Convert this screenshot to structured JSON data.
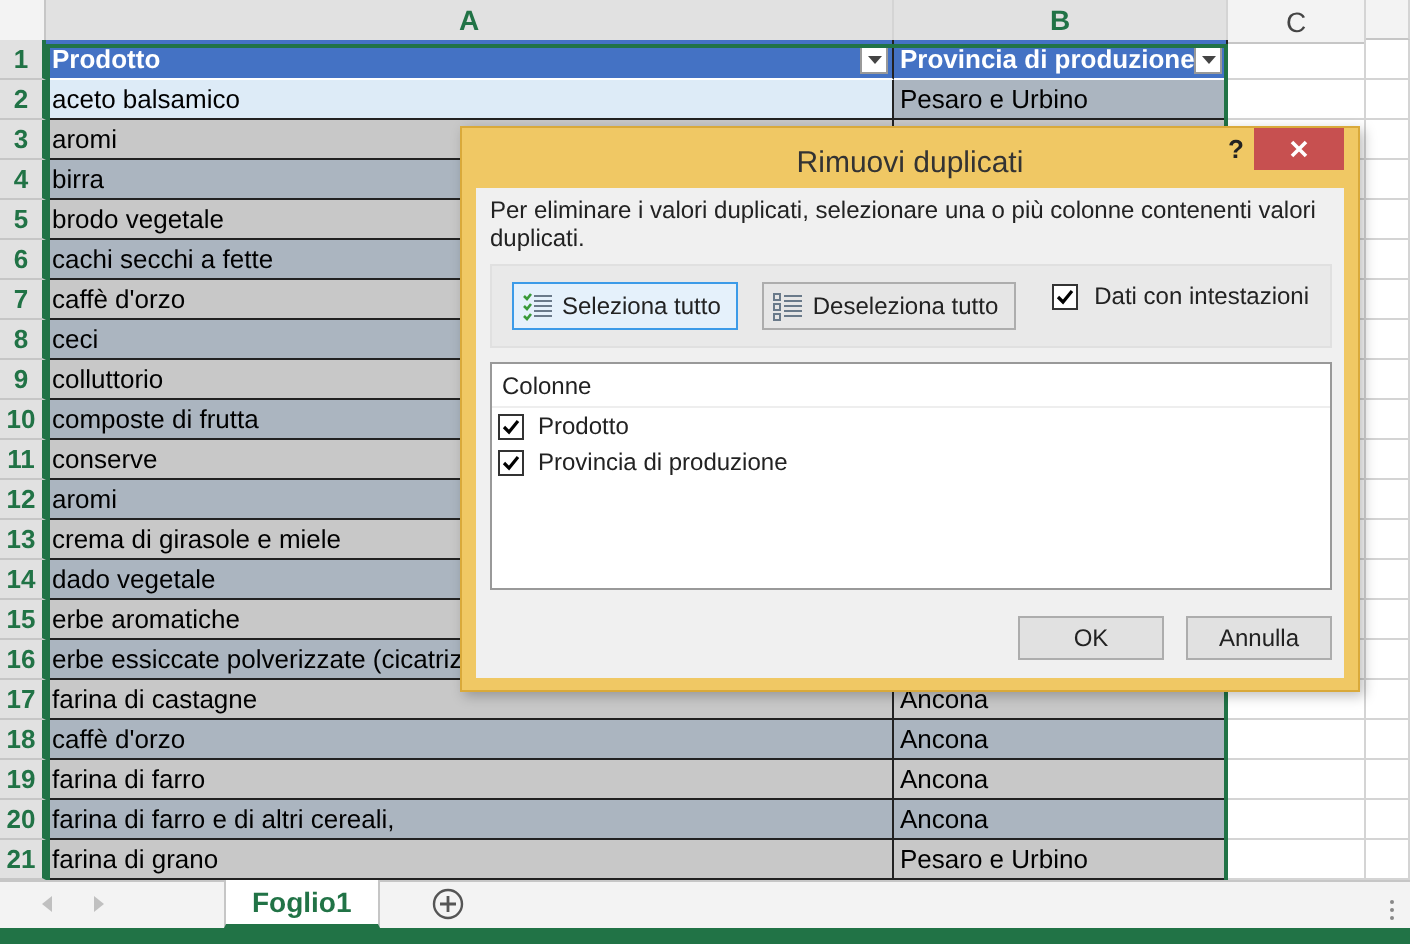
{
  "column_headers": [
    {
      "label": "A",
      "selected": true
    },
    {
      "label": "B",
      "selected": true
    },
    {
      "label": "C",
      "selected": false
    }
  ],
  "rows": [
    {
      "number": "1",
      "kind": "header",
      "cells": [
        "Prodotto",
        "Provincia di produzione"
      ]
    },
    {
      "number": "2",
      "kind": "data",
      "active": true,
      "cells": [
        "aceto balsamico",
        "Pesaro e Urbino"
      ]
    },
    {
      "number": "3",
      "kind": "data",
      "active": false,
      "cells": [
        "aromi"
      ]
    },
    {
      "number": "4",
      "kind": "data",
      "active": false,
      "cells": [
        "birra"
      ]
    },
    {
      "number": "5",
      "kind": "data",
      "active": false,
      "cells": [
        "brodo vegetale"
      ]
    },
    {
      "number": "6",
      "kind": "data",
      "active": false,
      "cells": [
        "cachi secchi a fette"
      ]
    },
    {
      "number": "7",
      "kind": "data",
      "active": false,
      "cells": [
        "caffè d'orzo"
      ]
    },
    {
      "number": "8",
      "kind": "data",
      "active": false,
      "cells": [
        "ceci"
      ]
    },
    {
      "number": "9",
      "kind": "data",
      "active": false,
      "cells": [
        "colluttorio"
      ]
    },
    {
      "number": "10",
      "kind": "data",
      "active": false,
      "cells": [
        "composte di frutta"
      ]
    },
    {
      "number": "11",
      "kind": "data",
      "active": false,
      "cells": [
        "conserve"
      ]
    },
    {
      "number": "12",
      "kind": "data",
      "active": false,
      "cells": [
        "aromi"
      ]
    },
    {
      "number": "13",
      "kind": "data",
      "active": false,
      "cells": [
        "crema di girasole e miele"
      ]
    },
    {
      "number": "14",
      "kind": "data",
      "active": false,
      "cells": [
        "dado vegetale"
      ]
    },
    {
      "number": "15",
      "kind": "data",
      "active": false,
      "cells": [
        "erbe aromatiche"
      ]
    },
    {
      "number": "16",
      "kind": "data",
      "active": false,
      "cells": [
        "erbe essiccate polverizzate (cicatriz"
      ]
    },
    {
      "number": "17",
      "kind": "data",
      "active": false,
      "cells": [
        "farina di castagne",
        "Ancona"
      ]
    },
    {
      "number": "18",
      "kind": "data",
      "active": false,
      "cells": [
        "caffè d'orzo",
        "Ancona"
      ]
    },
    {
      "number": "19",
      "kind": "data",
      "active": false,
      "cells": [
        "farina di farro",
        "Ancona"
      ]
    },
    {
      "number": "20",
      "kind": "data",
      "active": false,
      "cells": [
        "farina di farro e di altri cereali,",
        "Ancona"
      ]
    },
    {
      "number": "21",
      "kind": "data",
      "active": false,
      "cells": [
        "farina di grano",
        "Pesaro e Urbino"
      ]
    }
  ],
  "sheet_tabs": [
    {
      "label": "Foglio1",
      "selected": true
    }
  ],
  "dialog": {
    "title": "Rimuovi duplicati",
    "help": "?",
    "description": "Per eliminare i valori duplicati, selezionare una o più colonne contenenti valori duplicati.",
    "select_all": "Seleziona tutto",
    "deselect_all": "Deseleziona tutto",
    "has_headers": {
      "label": "Dati con intestazioni",
      "checked": true
    },
    "list_header": "Colonne",
    "columns": [
      {
        "label": "Prodotto",
        "checked": true
      },
      {
        "label": "Provincia di produzione",
        "checked": true
      }
    ],
    "ok": "OK",
    "cancel": "Annulla"
  }
}
